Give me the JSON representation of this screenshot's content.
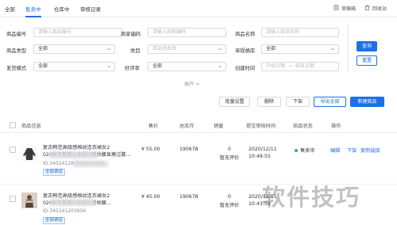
{
  "tabs": [
    {
      "label": "全部"
    },
    {
      "label": "售卖中"
    },
    {
      "label": "仓库中"
    },
    {
      "label": "审核记录"
    }
  ],
  "top_links": [
    {
      "label": "草稿箱",
      "icon": "draft-icon"
    },
    {
      "label": "回收站",
      "icon": "trash-icon"
    }
  ],
  "filters": {
    "product_code": {
      "label": "商品编号",
      "placeholder": "请输入商品编号"
    },
    "merchant_code": {
      "label": "商家编码",
      "placeholder": "请输入商家编码"
    },
    "product_name": {
      "label": "商品名称",
      "placeholder": "请输入商品名称"
    },
    "product_type": {
      "label": "商品类型",
      "value": "全部"
    },
    "category": {
      "label": "类目",
      "placeholder": "请选择类目"
    },
    "single_sku": {
      "label": "单规格库",
      "value": "全部"
    },
    "ship_mode": {
      "label": "发货模式",
      "value": "全部"
    },
    "rating": {
      "label": "好评率",
      "value": "全部"
    },
    "created_time": {
      "label": "创建时间",
      "start_placeholder": "开始日期",
      "sep": "→",
      "end_placeholder": "结束日期"
    },
    "expand_label": "展开"
  },
  "buttons": {
    "search": "查询",
    "reset": "重置",
    "batch_settings": "批量设置",
    "delete": "删除",
    "take_down": "下架",
    "export_all": "导出全部",
    "new_product": "新建商品"
  },
  "table": {
    "headers": {
      "info": "商品信息",
      "price": "售价",
      "stock": "总库存",
      "sales": "销量",
      "submit_time": "提交审核时间",
      "status": "商品状态",
      "actions": "操作"
    },
    "rows": [
      {
        "name_line1": "复古韩范高级感格纹连衣裙女2",
        "name_line2": "020秋冬新款小众设计感收腰显瘦过膝...",
        "id": "ID:34524128196563768S",
        "tag": "全部渠道",
        "price": "¥ 55.00",
        "stock": "190678",
        "sales": "0",
        "rating": "暂无评价",
        "date": "2020/12/11",
        "time": "10:49:55",
        "status": "售卖中",
        "ops": [
          "编辑",
          "下架",
          "复制链接"
        ]
      },
      {
        "name_line1": "复古韩范高级感格纹连衣裙女2",
        "name_line2": "020秋冬新款小众设计感收腰...",
        "id": "ID:345241203956",
        "tag": "全部渠道",
        "price": "¥ 45.00",
        "stock": "190678",
        "sales": "0",
        "rating": "暂无评价",
        "date": "2020/12/11",
        "time": "10:43:58",
        "status": "",
        "ops": [
          "",
          "",
          ""
        ]
      }
    ]
  },
  "watermark": "软件技巧",
  "colors": {
    "accent": "#1f6fe5",
    "status_green": "#2bb673"
  }
}
